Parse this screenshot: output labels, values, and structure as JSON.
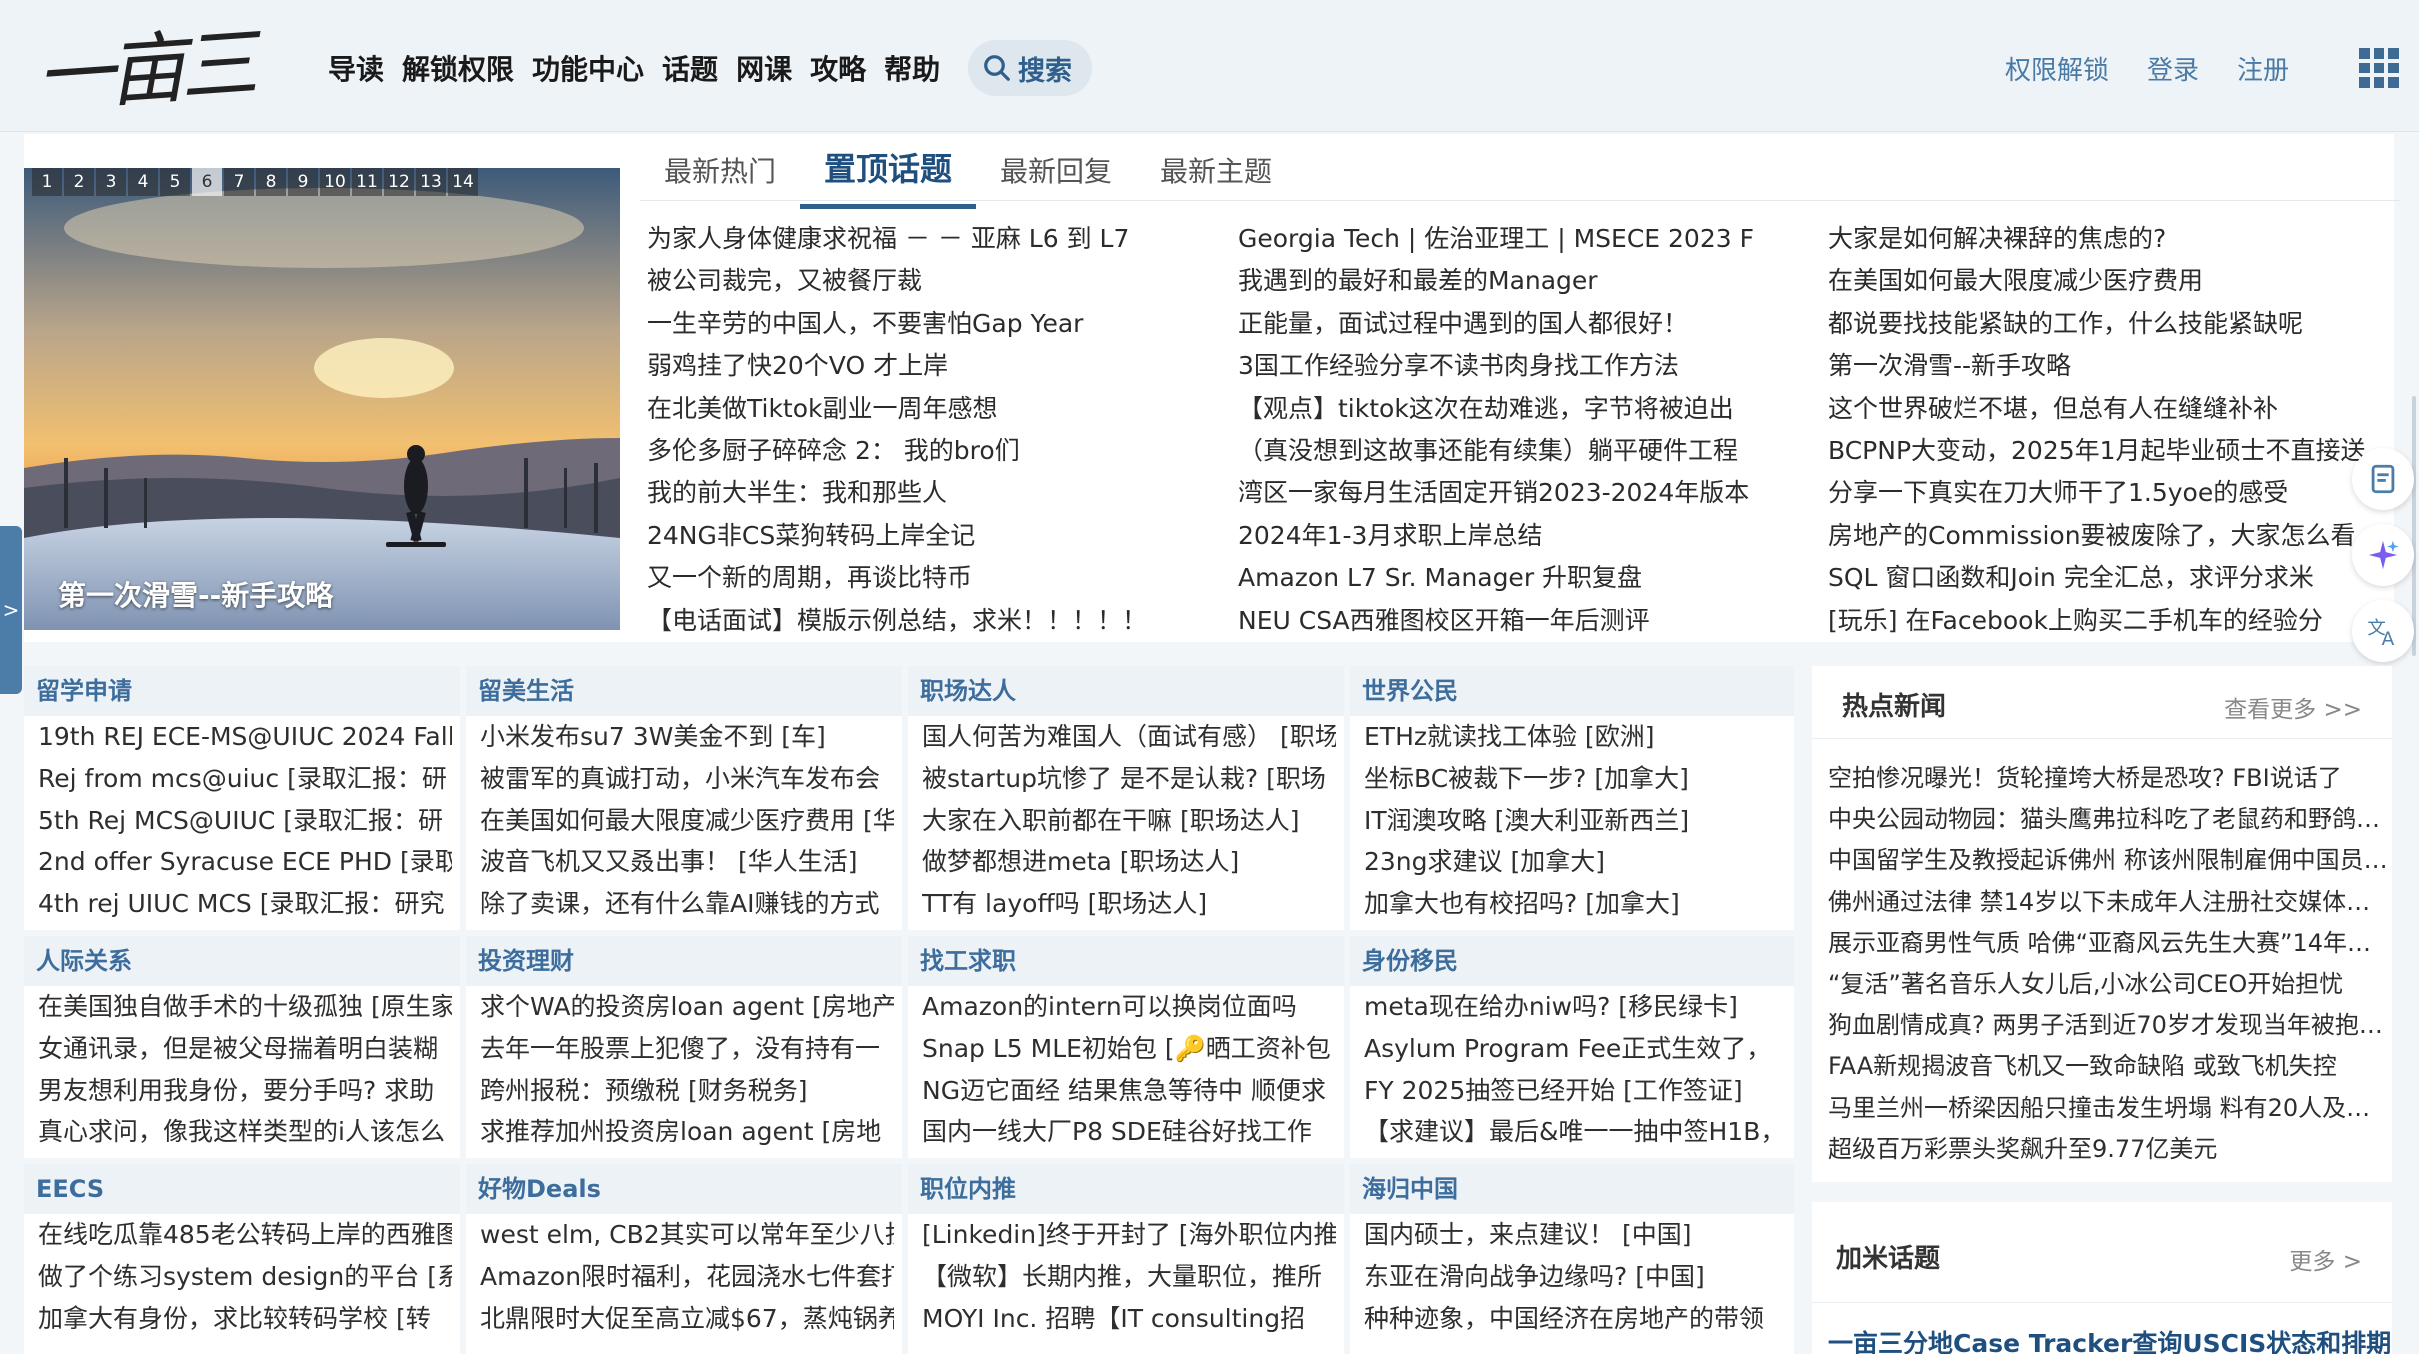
{
  "header": {
    "logo_text": "一亩三分地",
    "nav": [
      "导读",
      "解锁权限",
      "功能中心",
      "话题",
      "网课",
      "攻略",
      "帮助"
    ],
    "search_label": "搜索",
    "right_links": [
      "权限解锁",
      "登录",
      "注册"
    ]
  },
  "slider": {
    "numbers": [
      "1",
      "2",
      "3",
      "4",
      "5",
      "6",
      "7",
      "8",
      "9",
      "10",
      "11",
      "12",
      "13",
      "14"
    ],
    "active_index": 6,
    "caption": "第一次滑雪--新手攻略"
  },
  "left_tab_label": ">",
  "tabs": [
    "最新热门",
    "置顶话题",
    "最新回复",
    "最新主题"
  ],
  "topics": {
    "col1": [
      "为家人身体健康求祝福 － － 亚麻 L6 到 L7",
      "被公司裁完，又被餐厅裁",
      "一生辛劳的中国人，不要害怕Gap Year",
      "弱鸡挂了快20个VO 才上岸",
      "在北美做Tiktok副业一周年感想",
      "多伦多厨子碎碎念 2： 我的bro们",
      "我的前大半生：我和那些人",
      "24NG非CS菜狗转码上岸全记",
      "又一个新的周期，再谈比特币",
      "【电话面试】模版示例总结，求米！！！！！"
    ],
    "col2": [
      "Georgia Tech | 佐治亚理工 | MSECE 2023 F",
      "我遇到的最好和最差的Manager",
      "正能量，面试过程中遇到的国人都很好！",
      "3国工作经验分享不读书肉身找工作方法",
      "【观点】tiktok这次在劫难逃，字节将被迫出",
      "（真没想到这故事还能有续集）躺平硬件工程",
      "湾区一家每月生活固定开销2023-2024年版本",
      "2024年1-3月求职上岸总结",
      "Amazon L7 Sr. Manager 升职复盘",
      "NEU CSA西雅图校区开箱一年后测评"
    ],
    "col3": [
      "大家是如何解决裸辞的焦虑的?",
      "在美国如何最大限度减少医疗费用",
      "都说要找技能紧缺的工作，什么技能紧缺呢",
      "第一次滑雪--新手攻略",
      "这个世界破烂不堪，但总有人在缝缝补补",
      "BCPNP大变动，2025年1月起毕业硕士不直接送",
      "分享一下真实在刀大师干了1.5yoe的感受",
      "房地产的Commission要被废除了，大家怎么看",
      "SQL 窗口函数和Join 完全汇总，求评分求米",
      "[玩乐] 在Facebook上购买二手机车的经验分"
    ]
  },
  "forums": [
    {
      "title": "留学申请",
      "items": [
        "19th REJ ECE-MS@UIUC 2024 Fall",
        "Rej from mcs@uiuc [录取汇报：研",
        "5th Rej MCS@UIUC [录取汇报：研",
        "2nd offer Syracuse ECE PHD [录取",
        "4th rej UIUC MCS [录取汇报：研究"
      ]
    },
    {
      "title": "留美生活",
      "items": [
        "小米发布su7 3W美金不到 [车]",
        "被雷军的真诚打动，小米汽车发布会",
        "在美国如何最大限度减少医疗费用 [华",
        "波音飞机又又叒出事！ [华人生活]",
        "除了卖课，还有什么靠AI赚钱的方式"
      ]
    },
    {
      "title": "职场达人",
      "items": [
        "国人何苦为难国人（面试有感） [职场",
        "被startup坑惨了 是不是认栽? [职场",
        "大家在入职前都在干嘛 [职场达人]",
        "做梦都想进meta [职场达人]",
        "TT有 layoff吗 [职场达人]"
      ]
    },
    {
      "title": "世界公民",
      "items": [
        "ETHz就读找工体验 [欧洲]",
        "坐标BC被裁下一步? [加拿大]",
        "IT润澳攻略 [澳大利亚新西兰]",
        "23ng求建议 [加拿大]",
        "加拿大也有校招吗? [加拿大]"
      ]
    },
    {
      "title": "人际关系",
      "items": [
        "在美国独自做手术的十级孤独 [原生家",
        "女通讯录，但是被父母揣着明白装糊",
        "男友想利用我身份，要分手吗? 求助",
        "真心求问，像我这样类型的i人该怎么"
      ]
    },
    {
      "title": "投资理财",
      "items": [
        "求个WA的投资房loan agent [房地产]",
        "去年一年股票上犯傻了，没有持有一",
        "跨州报税：预缴税 [财务税务]",
        "求推荐加州投资房loan agent [房地"
      ]
    },
    {
      "title": "找工求职",
      "items": [
        "Amazon的intern可以换岗位面吗",
        "Snap L5 MLE初始包 [🔑晒工资补包",
        "NG迈它面经 结果焦急等待中 顺便求",
        "国内一线大厂P8 SDE硅谷好找工作"
      ]
    },
    {
      "title": "身份移民",
      "items": [
        "meta现在给办niw吗? [移民绿卡]",
        "Asylum Program Fee正式生效了，",
        "FY 2025抽签已经开始 [工作签证]",
        "【求建议】最后&唯一一抽中签H1B，"
      ]
    },
    {
      "title": "EECS",
      "items": [
        "在线吃瓜靠485老公转码上岸的西雅图",
        "做了个练习system design的平台 [系",
        "加拿大有身份，求比较转码学校 [转"
      ]
    },
    {
      "title": "好物Deals",
      "items": [
        "west elm, CB2其实可以常年至少八折",
        "Amazon限时福利，花园浇水七件套打",
        "北鼎限时大促至高立减$67，蒸炖锅养"
      ]
    },
    {
      "title": "职位内推",
      "items": [
        "[Linkedin]终于开封了 [海外职位内推]",
        "【微软】长期内推，大量职位，推所",
        "MOYI Inc. 招聘【IT consulting招"
      ]
    },
    {
      "title": "海归中国",
      "items": [
        "国内硕士，来点建议！ [中国]",
        "东亚在滑向战争边缘吗? [中国]",
        "种种迹象，中国经济在房地产的带领"
      ]
    }
  ],
  "hot_news": {
    "title": "热点新闻",
    "more": "查看更多 >>",
    "items": [
      "空拍惨况曝光！货轮撞垮大桥是恐攻? FBI说话了",
      "中央公园动物园：猫头鹰弗拉科吃了老鼠药和野鸽…",
      "中国留学生及教授起诉佛州 称该州限制雇佣中国员…",
      "佛州通过法律 禁14岁以下未成年人注册社交媒体账户",
      "展示亚裔男性气质 哈佛“亚裔风云先生大赛”14年…",
      "“复活”著名音乐人女儿后,小冰公司CEO开始担忧",
      "狗血剧情成真? 两男子活到近70岁才发现当年被抱…",
      "FAA新规揭波音飞机又一致命缺陷 或致飞机失控",
      "马里兰州一桥梁因船只撞击发生坍塌 料有20人及多…",
      "超级百万彩票头奖飙升至9.77亿美元"
    ]
  },
  "jiami": {
    "title": "加米话题",
    "more": "更多 >",
    "first_item": "一亩三分地Case Tracker查询USCIS状态和排期"
  },
  "colors": {
    "accent": "#2f5f8c",
    "forum_head_bg": "#edf2f6",
    "header_bg": "#eef3f7"
  }
}
